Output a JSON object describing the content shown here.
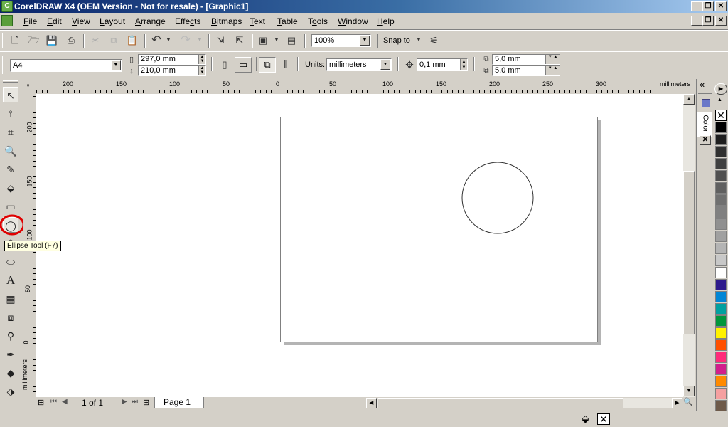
{
  "window": {
    "title": "CorelDRAW X4 (OEM Version - Not for resale) - [Graphic1]",
    "controls": [
      "_",
      "❐",
      "✕"
    ]
  },
  "menu": [
    {
      "label": "File",
      "u": "F"
    },
    {
      "label": "Edit",
      "u": "E"
    },
    {
      "label": "View",
      "u": "V"
    },
    {
      "label": "Layout",
      "u": "L"
    },
    {
      "label": "Arrange",
      "u": "A"
    },
    {
      "label": "Effects",
      "u": "c"
    },
    {
      "label": "Bitmaps",
      "u": "B"
    },
    {
      "label": "Text",
      "u": "T"
    },
    {
      "label": "Table",
      "u": "T"
    },
    {
      "label": "Tools",
      "u": "o"
    },
    {
      "label": "Window",
      "u": "W"
    },
    {
      "label": "Help",
      "u": "H"
    }
  ],
  "standard_toolbar": {
    "zoom": "100%",
    "snap_to": "Snap to"
  },
  "property_bar": {
    "page_size": "A4",
    "width": "297,0 mm",
    "height": "210,0 mm",
    "units_label": "Units:",
    "units": "millimeters",
    "nudge": "0,1 mm",
    "dup_x": "5,0 mm",
    "dup_y": "5,0 mm"
  },
  "toolbox": {
    "tooltip": "Ellipse Tool (F7)",
    "active_tool": "ellipse"
  },
  "ruler": {
    "unit": "millimeters",
    "h_labels": [
      "200",
      "150",
      "100",
      "50",
      "0",
      "50",
      "100",
      "150",
      "200",
      "250",
      "300"
    ],
    "v_labels": [
      "200",
      "150",
      "100",
      "50",
      "0"
    ]
  },
  "docker": {
    "tab_label": "Color"
  },
  "page_nav": {
    "count": "1 of 1",
    "tab": "Page 1"
  },
  "colors": {
    "highlight_circle": "#e00000",
    "palette": [
      "#000000",
      "#1e1e1e",
      "#303030",
      "#404040",
      "#505050",
      "#606060",
      "#707070",
      "#808080",
      "#909090",
      "#a0a0a0",
      "#b4b4b4",
      "#c8c8c8",
      "#ffffff",
      "#2e1a8c",
      "#0086d6",
      "#00a0a0",
      "#00963c",
      "#fff200",
      "#ff5000",
      "#ff2a7a",
      "#d21e8c",
      "#ff8a00",
      "#f5a0a0",
      "#6e5a4a"
    ]
  }
}
